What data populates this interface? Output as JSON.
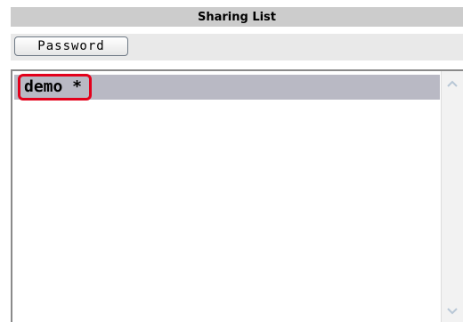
{
  "panel": {
    "title": "Sharing List"
  },
  "toolbar": {
    "password_label": "Password"
  },
  "list": {
    "items": [
      {
        "label": "demo *",
        "selected": true,
        "highlighted": true
      }
    ]
  },
  "icons": {
    "scroll_up": "chevron-up-icon",
    "scroll_down": "chevron-down-icon"
  },
  "colors": {
    "header_bg": "#cccccc",
    "toolbar_bg": "#e9e9e9",
    "selection_bg": "#b9b9c4",
    "highlight_border": "#e3001b"
  }
}
